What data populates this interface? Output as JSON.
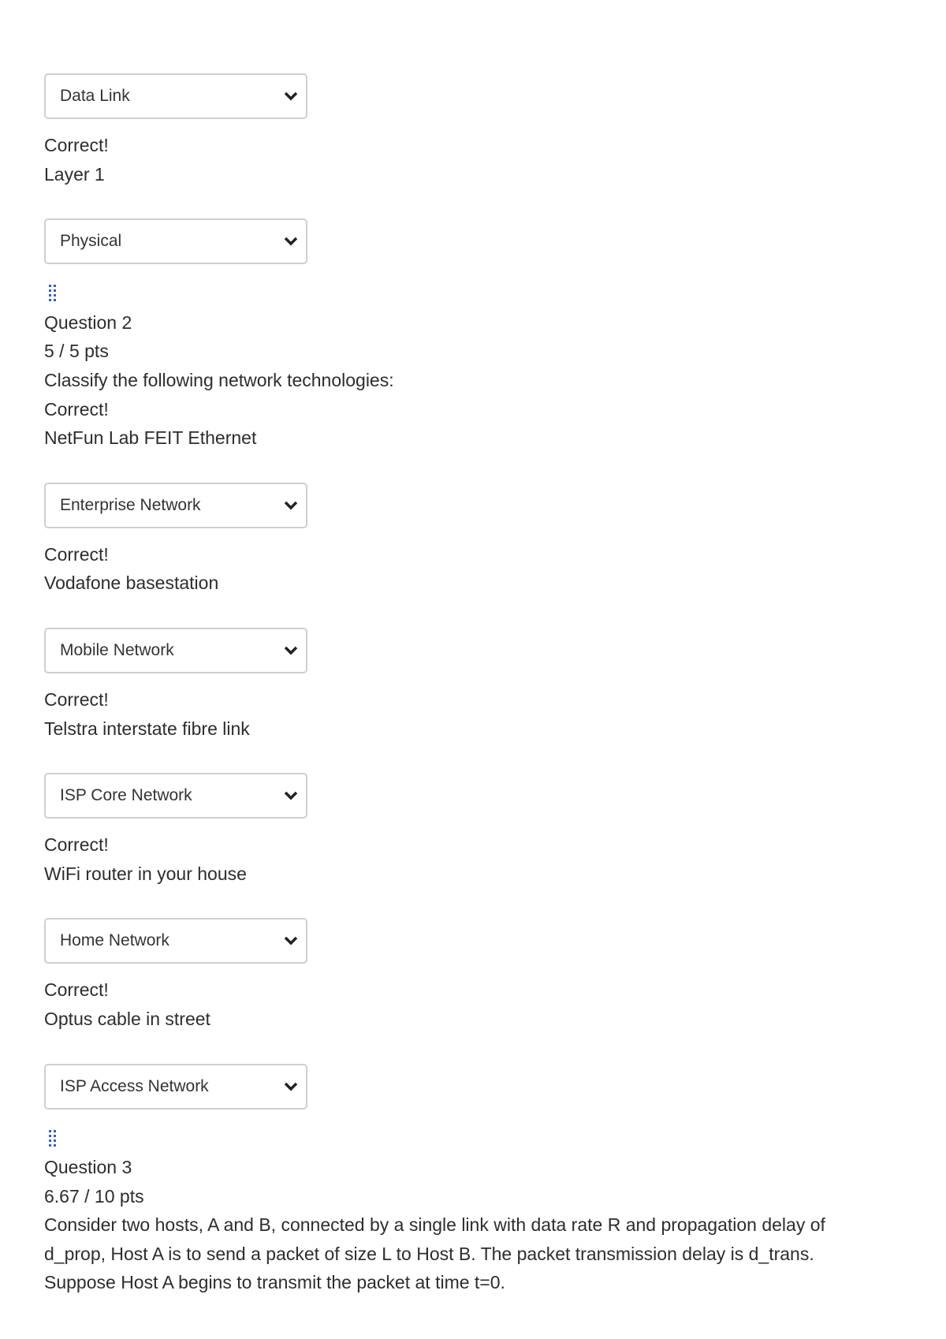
{
  "q1_tail": {
    "select1": "Data Link",
    "feedback1": "Correct!",
    "item2": "Layer 1",
    "select2": "Physical"
  },
  "q2": {
    "title": "Question 2",
    "points": "5 / 5 pts",
    "prompt": "Classify the following network technologies:",
    "items": [
      {
        "feedback": "Correct!",
        "label": "NetFun Lab FEIT Ethernet",
        "answer": "Enterprise Network"
      },
      {
        "feedback": "Correct!",
        "label": "Vodafone basestation",
        "answer": "Mobile Network"
      },
      {
        "feedback": "Correct!",
        "label": "Telstra interstate fibre link",
        "answer": "ISP Core Network"
      },
      {
        "feedback": "Correct!",
        "label": "WiFi router in your house",
        "answer": "Home Network"
      },
      {
        "feedback": "Correct!",
        "label": "Optus cable in street",
        "answer": "ISP Access Network"
      }
    ]
  },
  "q3": {
    "title": "Question 3",
    "points": "6.67 / 10 pts",
    "text": "Consider two hosts, A and B, connected by a single link with data rate R and propagation delay of d_prop, Host A is to send a packet of size L to Host B. The packet transmission delay is d_trans. Suppose Host A begins to transmit the packet at time t=0."
  },
  "colors": {
    "accent": "#2f5fd0",
    "border": "#cfcfcf",
    "text": "#2d2d2d"
  }
}
